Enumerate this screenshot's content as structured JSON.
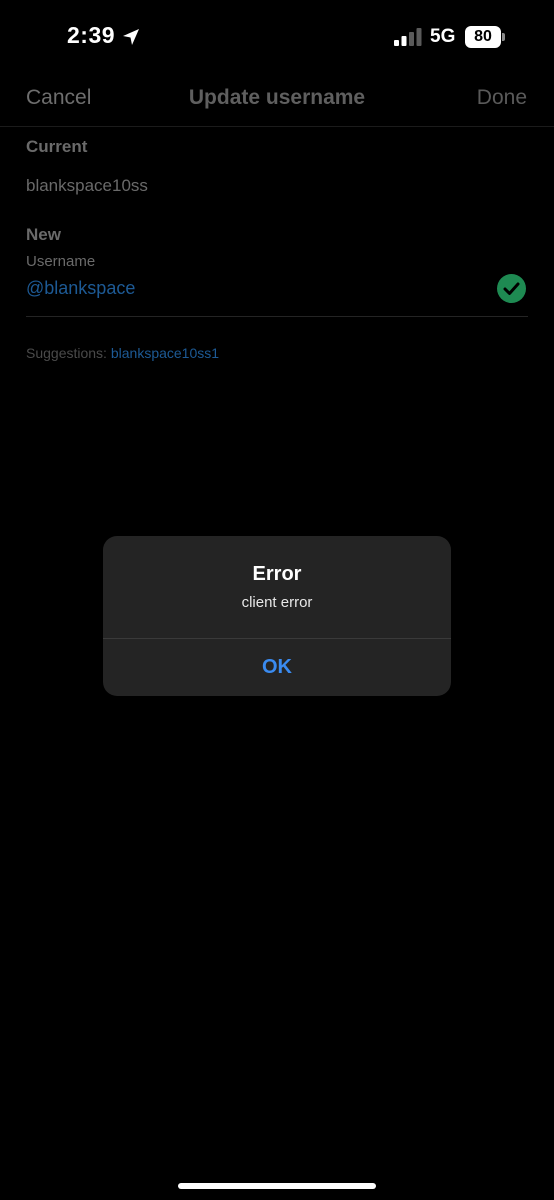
{
  "status_bar": {
    "time": "2:39",
    "network": "5G",
    "battery_level": "80",
    "location_icon": "location-arrow-icon",
    "signal_icon": "cellular-signal-icon",
    "battery_icon": "battery-icon"
  },
  "nav": {
    "cancel_label": "Cancel",
    "title": "Update username",
    "done_label": "Done"
  },
  "current": {
    "heading": "Current",
    "value": "blankspace10ss"
  },
  "new": {
    "heading": "New",
    "field_label": "Username",
    "field_value": "@blankspace",
    "valid_icon": "checkmark-circle-icon"
  },
  "suggestions": {
    "prefix": "Suggestions: ",
    "items": [
      "blankspace10ss1"
    ]
  },
  "alert": {
    "title": "Error",
    "message": "client error",
    "ok_label": "OK"
  },
  "colors": {
    "background": "#000000",
    "link_blue": "#1d5a95",
    "alert_button_blue": "#3a8bf0",
    "valid_green": "#1e8a52",
    "alert_background": "#242424"
  }
}
